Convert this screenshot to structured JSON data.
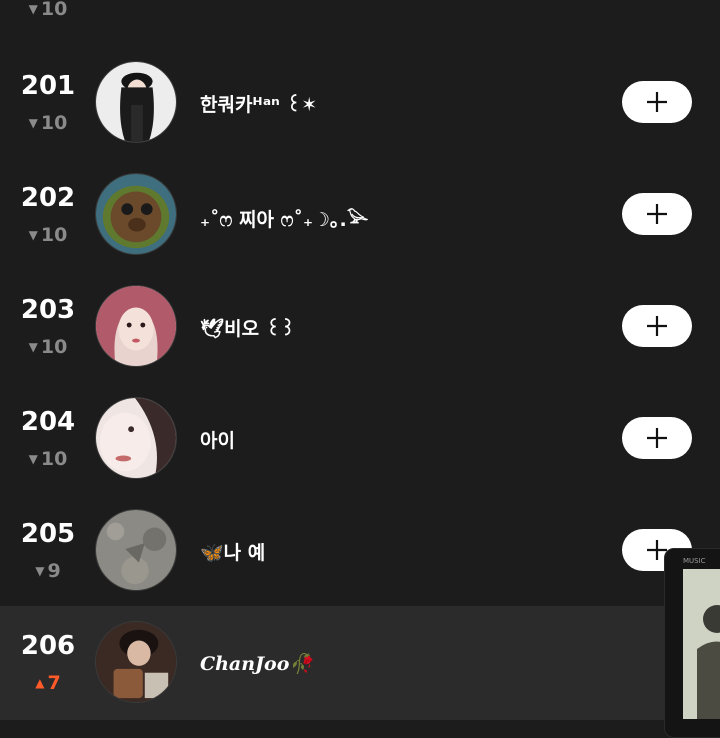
{
  "list": {
    "rows": [
      {
        "rank": "",
        "delta": "10",
        "direction": "down",
        "name": ""
      },
      {
        "rank": "201",
        "delta": "10",
        "direction": "down",
        "name": "한쿼카ᴴᵃⁿ ꒰✶"
      },
      {
        "rank": "202",
        "delta": "10",
        "direction": "down",
        "name": "₊˚ෆ 찌아 ෆ˚₊☽｡.𓅪"
      },
      {
        "rank": "203",
        "delta": "10",
        "direction": "down",
        "name": "🕊비오 ꒰꒱"
      },
      {
        "rank": "204",
        "delta": "10",
        "direction": "down",
        "name": "아이"
      },
      {
        "rank": "205",
        "delta": "9",
        "direction": "down",
        "name": "🦋나 예"
      },
      {
        "rank": "206",
        "delta": "7",
        "direction": "up",
        "name": "ChanJoo🥀"
      }
    ]
  },
  "icons": {
    "down": "triangle-down-icon",
    "up": "triangle-up-icon",
    "add": "plus-icon"
  },
  "colors": {
    "background": "#1c1c1c",
    "highlight_row": "#2b2b2b",
    "down": "#8a8a8a",
    "up": "#ff5a2a",
    "button": "#ffffff"
  },
  "mini_player": {
    "label": "MUSIC"
  }
}
